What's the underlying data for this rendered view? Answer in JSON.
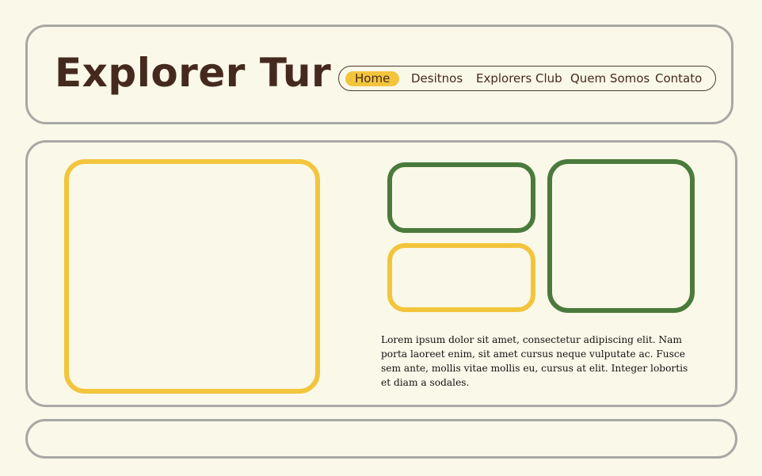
{
  "header": {
    "brand": "Explorer Tur",
    "nav": [
      {
        "label": "Home",
        "active": true
      },
      {
        "label": "Desitnos",
        "active": false
      },
      {
        "label": "Explorers Club",
        "active": false
      },
      {
        "label": "Quem Somos",
        "active": false
      },
      {
        "label": "Contato",
        "active": false
      }
    ]
  },
  "main": {
    "description": "Lorem ipsum dolor sit amet, consectetur adipiscing elit. Nam porta laoreet enim, sit amet cursus neque vulputate ac. Fusce sem ante, mollis vitae mollis eu, cursus at elit. Integer lobortis et diam a sodales."
  },
  "colors": {
    "background": "#faf8e8",
    "accent_yellow": "#f2c53d",
    "accent_green": "#4a7a3c",
    "brand_text": "#45291f",
    "panel_border": "#a8a8a4"
  }
}
